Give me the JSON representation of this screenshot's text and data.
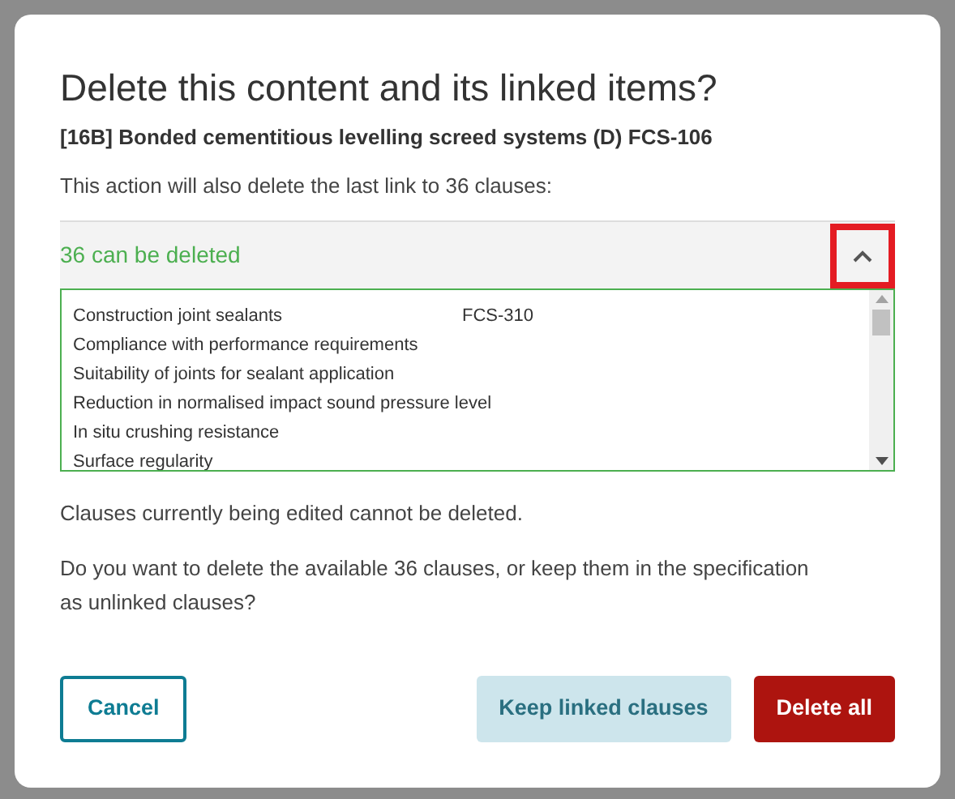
{
  "dialog": {
    "title": "Delete this content and its linked items?",
    "subtitle": "[16B] Bonded cementitious levelling screed systems (D) FCS-106",
    "intro": "This action will also delete the last link to 36 clauses:",
    "accordion": {
      "label": "36 can be deleted",
      "expanded": true,
      "highlighted": true,
      "rows": [
        {
          "name": "Construction joint sealants",
          "code": "FCS-310"
        },
        {
          "name": "Compliance with performance requirements"
        },
        {
          "name": "Suitability of joints for sealant application"
        },
        {
          "name": "Reduction in normalised impact sound pressure level"
        },
        {
          "name": "In situ crushing resistance"
        },
        {
          "name": "Surface regularity"
        }
      ]
    },
    "note": "Clauses currently being edited cannot be deleted.",
    "question": "Do you want to delete the available 36 clauses, or keep them in the specification as unlinked clauses?",
    "buttons": [
      {
        "label": "Cancel",
        "kind": "outline"
      },
      {
        "label": "Keep linked clauses",
        "kind": "secondary"
      },
      {
        "label": "Delete all",
        "kind": "danger"
      }
    ]
  }
}
